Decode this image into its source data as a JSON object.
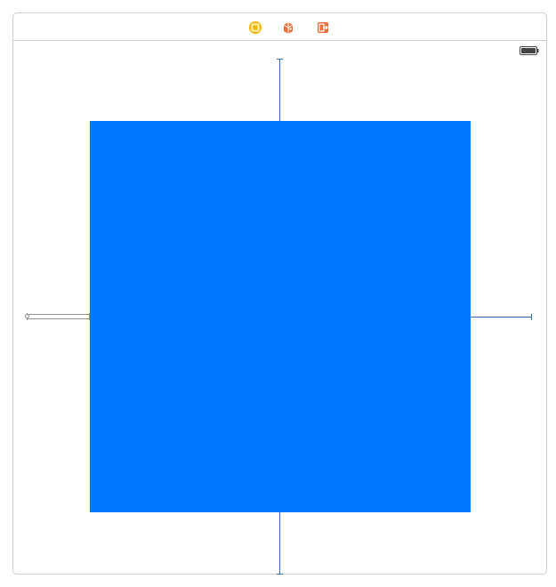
{
  "scene": {
    "dock_icons": [
      {
        "name": "view-controller-icon",
        "color": "#f2b300"
      },
      {
        "name": "first-responder-icon",
        "color": "#e8703a"
      },
      {
        "name": "exit-icon",
        "color": "#e8703a"
      }
    ],
    "status_bar": {
      "battery_icon": "battery-icon"
    },
    "canvas": {
      "blue_view_color": "#0077ff",
      "constraint_color": "#2f6fb5",
      "handle_color": "#8f8f8f"
    }
  }
}
